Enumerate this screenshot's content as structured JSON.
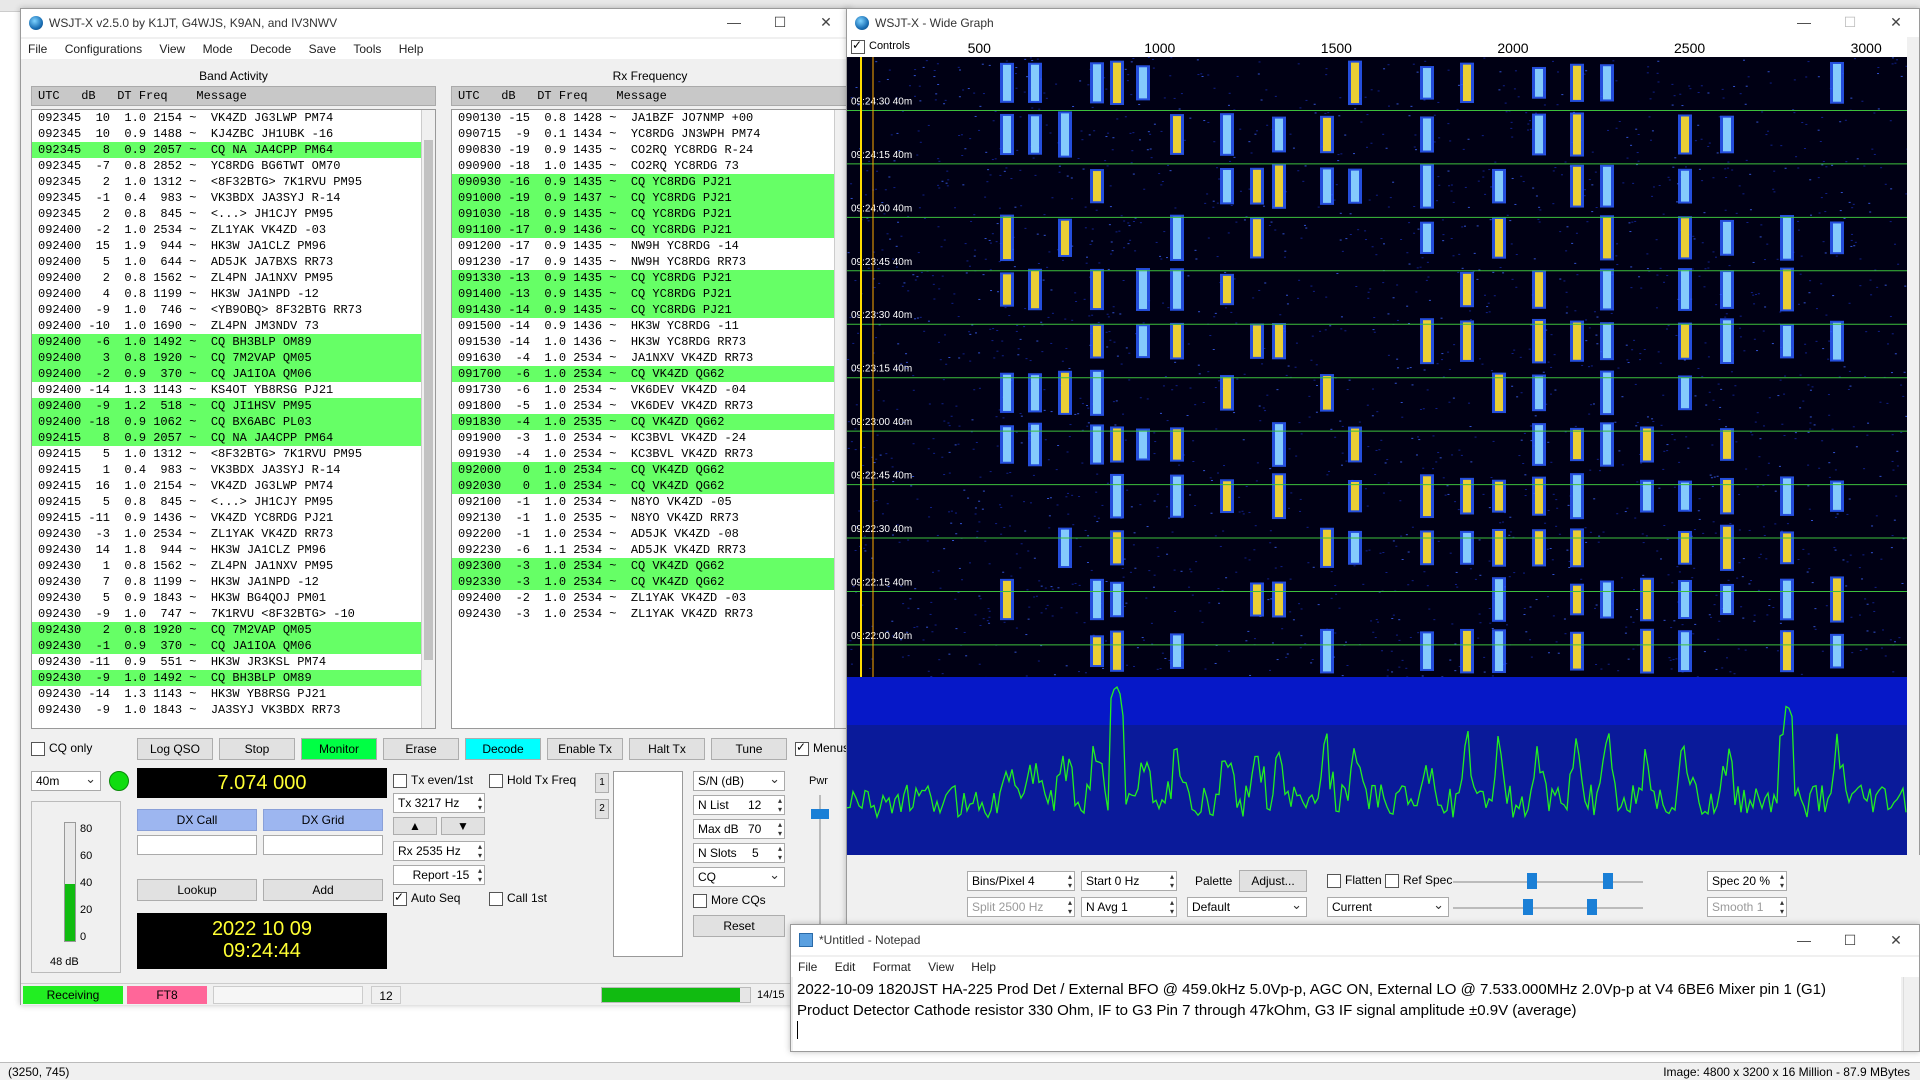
{
  "status_bar": {
    "coords": "(3250, 745)",
    "image_info": "Image: 4800 x 3200 x 16 Million - 87.9 MBytes"
  },
  "wsjtx": {
    "title": "WSJT-X   v2.5.0   by K1JT, G4WJS, K9AN, and IV3NWV",
    "menu": [
      "File",
      "Configurations",
      "View",
      "Mode",
      "Decode",
      "Save",
      "Tools",
      "Help"
    ],
    "band_activity": {
      "title": "Band Activity",
      "header": "UTC   dB   DT Freq    Message",
      "rows": [
        {
          "t": "092345  10  1.0 2154 ~  VK4ZD JG3LWP PM74",
          "cq": false
        },
        {
          "t": "092345  10  0.9 1488 ~  KJ4ZBC JH1UBK -16",
          "cq": false
        },
        {
          "t": "092345   8  0.9 2057 ~  CQ NA JA4CPP PM64",
          "cq": true
        },
        {
          "t": "092345  -7  0.8 2852 ~  YC8RDG BG6TWT OM70",
          "cq": false
        },
        {
          "t": "092345   2  1.0 1312 ~  <8F32BTG> 7K1RVU PM95",
          "cq": false
        },
        {
          "t": "092345  -1  0.4  983 ~  VK3BDX JA3SYJ R-14",
          "cq": false
        },
        {
          "t": "092345   2  0.8  845 ~  <...> JH1CJY PM95",
          "cq": false
        },
        {
          "t": "092400  -2  1.0 2534 ~  ZL1YAK VK4ZD -03",
          "cq": false
        },
        {
          "t": "092400  15  1.9  944 ~  HK3W JA1CLZ PM96",
          "cq": false
        },
        {
          "t": "092400   5  1.0  644 ~  AD5JK JA7BXS RR73",
          "cq": false
        },
        {
          "t": "092400   2  0.8 1562 ~  ZL4PN JA1NXV PM95",
          "cq": false
        },
        {
          "t": "092400   4  0.8 1199 ~  HK3W JA1NPD -12",
          "cq": false
        },
        {
          "t": "092400  -9  1.0  746 ~  <YB9OBQ> 8F32BTG RR73",
          "cq": false
        },
        {
          "t": "092400 -10  1.0 1690 ~  ZL4PN JM3NDV 73",
          "cq": false
        },
        {
          "t": "092400  -6  1.0 1492 ~  CQ BH3BLP OM89",
          "cq": true
        },
        {
          "t": "092400   3  0.8 1920 ~  CQ 7M2VAP QM05",
          "cq": true
        },
        {
          "t": "092400  -2  0.9  370 ~  CQ JA1IOA QM06",
          "cq": true
        },
        {
          "t": "092400 -14  1.3 1143 ~  KS4OT YB8RSG PJ21",
          "cq": false
        },
        {
          "t": "092400  -9  1.2  518 ~  CQ JI1HSV PM95",
          "cq": true
        },
        {
          "t": "092400 -18  0.9 1062 ~  CQ BX6ABC PL03",
          "cq": true
        },
        {
          "t": "092415   8  0.9 2057 ~  CQ NA JA4CPP PM64",
          "cq": true
        },
        {
          "t": "092415   5  1.0 1312 ~  <8F32BTG> 7K1RVU PM95",
          "cq": false
        },
        {
          "t": "092415   1  0.4  983 ~  VK3BDX JA3SYJ R-14",
          "cq": false
        },
        {
          "t": "092415  16  1.0 2154 ~  VK4ZD JG3LWP PM74",
          "cq": false
        },
        {
          "t": "092415   5  0.8  845 ~  <...> JH1CJY PM95",
          "cq": false
        },
        {
          "t": "092415 -11  0.9 1436 ~  VK4ZD YC8RDG PJ21",
          "cq": false
        },
        {
          "t": "092430  -3  1.0 2534 ~  ZL1YAK VK4ZD RR73",
          "cq": false
        },
        {
          "t": "092430  14  1.8  944 ~  HK3W JA1CLZ PM96",
          "cq": false
        },
        {
          "t": "092430   1  0.8 1562 ~  ZL4PN JA1NXV PM95",
          "cq": false
        },
        {
          "t": "092430   7  0.8 1199 ~  HK3W JA1NPD -12",
          "cq": false
        },
        {
          "t": "092430   5  0.9 1843 ~  HK3W BG4QOJ PM01",
          "cq": false
        },
        {
          "t": "092430  -9  1.0  747 ~  7K1RVU <8F32BTG> -10",
          "cq": false
        },
        {
          "t": "092430   2  0.8 1920 ~  CQ 7M2VAP QM05",
          "cq": true
        },
        {
          "t": "092430  -1  0.9  370 ~  CQ JA1IOA QM06",
          "cq": true
        },
        {
          "t": "092430 -11  0.9  551 ~  HK3W JR3KSL PM74",
          "cq": false
        },
        {
          "t": "092430  -9  1.0 1492 ~  CQ BH3BLP OM89",
          "cq": true
        },
        {
          "t": "092430 -14  1.3 1143 ~  HK3W YB8RSG PJ21",
          "cq": false
        },
        {
          "t": "092430  -9  1.0 1843 ~  JA3SYJ VK3BDX RR73",
          "cq": false
        }
      ]
    },
    "rx_frequency": {
      "title": "Rx Frequency",
      "header": "UTC   dB   DT Freq    Message",
      "rows": [
        {
          "t": "090130 -15  0.8 1428 ~  JA1BZF JO7NMP +00",
          "cq": false
        },
        {
          "t": "090715  -9  0.1 1434 ~  YC8RDG JN3WPH PM74",
          "cq": false
        },
        {
          "t": "090830 -19  0.9 1435 ~  CO2RQ YC8RDG R-24",
          "cq": false
        },
        {
          "t": "090900 -18  1.0 1435 ~  CO2RQ YC8RDG 73",
          "cq": false
        },
        {
          "t": "090930 -16  0.9 1435 ~  CQ YC8RDG PJ21",
          "cq": true
        },
        {
          "t": "091000 -19  0.9 1437 ~  CQ YC8RDG PJ21",
          "cq": true
        },
        {
          "t": "091030 -18  0.9 1435 ~  CQ YC8RDG PJ21",
          "cq": true
        },
        {
          "t": "091100 -17  0.9 1436 ~  CQ YC8RDG PJ21",
          "cq": true
        },
        {
          "t": "091200 -17  0.9 1435 ~  NW9H YC8RDG -14",
          "cq": false
        },
        {
          "t": "091230 -17  0.9 1435 ~  NW9H YC8RDG RR73",
          "cq": false
        },
        {
          "t": "091330 -13  0.9 1435 ~  CQ YC8RDG PJ21",
          "cq": true
        },
        {
          "t": "091400 -13  0.9 1435 ~  CQ YC8RDG PJ21",
          "cq": true
        },
        {
          "t": "091430 -14  0.9 1435 ~  CQ YC8RDG PJ21",
          "cq": true
        },
        {
          "t": "091500 -14  0.9 1436 ~  HK3W YC8RDG -11",
          "cq": false
        },
        {
          "t": "091530 -14  1.0 1436 ~  HK3W YC8RDG RR73",
          "cq": false
        },
        {
          "t": "091630  -4  1.0 2534 ~  JA1NXV VK4ZD RR73",
          "cq": false
        },
        {
          "t": "091700  -6  1.0 2534 ~  CQ VK4ZD QG62",
          "cq": true
        },
        {
          "t": "091730  -6  1.0 2534 ~  VK6DEV VK4ZD -04",
          "cq": false
        },
        {
          "t": "091800  -5  1.0 2534 ~  VK6DEV VK4ZD RR73",
          "cq": false
        },
        {
          "t": "091830  -4  1.0 2535 ~  CQ VK4ZD QG62",
          "cq": true
        },
        {
          "t": "091900  -3  1.0 2534 ~  KC3BVL VK4ZD -24",
          "cq": false
        },
        {
          "t": "091930  -4  1.0 2534 ~  KC3BVL VK4ZD RR73",
          "cq": false
        },
        {
          "t": "092000   0  1.0 2534 ~  CQ VK4ZD QG62",
          "cq": true
        },
        {
          "t": "092030   0  1.0 2534 ~  CQ VK4ZD QG62",
          "cq": true
        },
        {
          "t": "092100  -1  1.0 2534 ~  N8YO VK4ZD -05",
          "cq": false
        },
        {
          "t": "092130  -1  1.0 2535 ~  N8YO VK4ZD RR73",
          "cq": false
        },
        {
          "t": "092200  -1  1.0 2534 ~  AD5JK VK4ZD -08",
          "cq": false
        },
        {
          "t": "092230  -6  1.1 2534 ~  AD5JK VK4ZD RR73",
          "cq": false
        },
        {
          "t": "092300  -3  1.0 2534 ~  CQ VK4ZD QG62",
          "cq": true
        },
        {
          "t": "092330  -3  1.0 2534 ~  CQ VK4ZD QG62",
          "cq": true
        },
        {
          "t": "092400  -2  1.0 2534 ~  ZL1YAK VK4ZD -03",
          "cq": false
        },
        {
          "t": "092430  -3  1.0 2534 ~  ZL1YAK VK4ZD RR73",
          "cq": false
        }
      ]
    },
    "controls": {
      "cq_only": "CQ only",
      "log_qso": "Log QSO",
      "stop": "Stop",
      "monitor": "Monitor",
      "erase": "Erase",
      "decode": "Decode",
      "enable_tx": "Enable Tx",
      "halt_tx": "Halt Tx",
      "tune": "Tune",
      "menus": "Menus",
      "band": "40m",
      "frequency": "7.074 000",
      "tx_even": "Tx even/1st",
      "hold_tx_freq": "Hold Tx Freq",
      "tx_freq": "Tx  3217  Hz",
      "rx_freq": "Rx  2535  Hz",
      "report": "Report -15",
      "auto_seq": "Auto Seq",
      "call_1st": "Call 1st",
      "dx_call": "DX Call",
      "dx_grid": "DX Grid",
      "lookup": "Lookup",
      "add": "Add",
      "date": "2022 10 09",
      "time": "09:24:44",
      "level_db": "48 dB",
      "level_ticks": [
        "80",
        "60",
        "40",
        "20",
        "0"
      ],
      "level_fraction": 0.48,
      "sn_db": "S/N (dB)",
      "n_list": "N List",
      "n_list_val": "12",
      "max_db": "Max dB",
      "max_db_val": "70",
      "n_slots": "N Slots",
      "n_slots_val": "5",
      "cq": "CQ",
      "more_cqs": "More CQs",
      "reset": "Reset",
      "pwr": "Pwr",
      "tab1": "1",
      "tab2": "2"
    },
    "statusbar": {
      "receiving": "Receiving",
      "mode": "FT8",
      "count": "12",
      "slot": "14/15",
      "progress_fraction": 0.93
    }
  },
  "wide_graph": {
    "title": "WSJT-X - Wide Graph",
    "controls_label": "Controls",
    "freq_ticks": [
      "500",
      "1000",
      "1500",
      "2000",
      "2500",
      "3000"
    ],
    "time_labels": [
      "09:24:30",
      "09:24:15",
      "09:24:00",
      "09:23:45",
      "09:23:30",
      "09:23:15",
      "09:23:00",
      "09:22:45",
      "09:22:30",
      "09:22:15",
      "09:22:00"
    ],
    "band_label": "40m",
    "bins_pixel": "Bins/Pixel  4",
    "start": "Start  0 Hz",
    "palette": "Palette",
    "adjust": "Adjust...",
    "flatten": "Flatten",
    "ref_spec": "Ref Spec",
    "spec": "Spec  20 %",
    "split": "Split  2500  Hz",
    "n_avg": "N Avg  1",
    "palette_value": "Default",
    "current": "Current",
    "smooth": "Smooth  1",
    "colors": {
      "trace": "#22ee22",
      "bg": "#000018",
      "hot": "#ffdd22"
    }
  },
  "notepad": {
    "title": "*Untitled - Notepad",
    "menu": [
      "File",
      "Edit",
      "Format",
      "View",
      "Help"
    ],
    "lines": [
      "2022-10-09 1820JST HA-225 Prod Det / External BFO @ 459.0kHz 5.0Vp-p, AGC ON, External LO @ 7.533.000MHz 2.0Vp-p at V4 6BE6 Mixer pin 1 (G1)",
      "Product Detector Cathode resistor 330 Ohm, IF to G3 Pin 7 through 47kOhm,  G3 IF signal amplitude ±0.9V (average)"
    ]
  }
}
